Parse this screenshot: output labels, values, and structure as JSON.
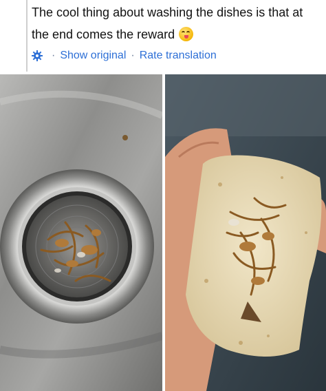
{
  "post": {
    "text": "The cool thing about washing the dishes is that at the end comes the reward",
    "emoji_icon": "yum-face-emoji",
    "translation_bar": {
      "icon": "gear-icon",
      "separator": "·",
      "show_original": "Show original",
      "rate_translation": "Rate translation"
    }
  },
  "images": {
    "left": {
      "depicts": "sink-drain-strainer-with-food-scraps"
    },
    "right": {
      "depicts": "hand-holding-tortilla-with-scraps"
    }
  },
  "colors": {
    "link": "#2d6fd6",
    "rule": "#cfcfcf"
  }
}
